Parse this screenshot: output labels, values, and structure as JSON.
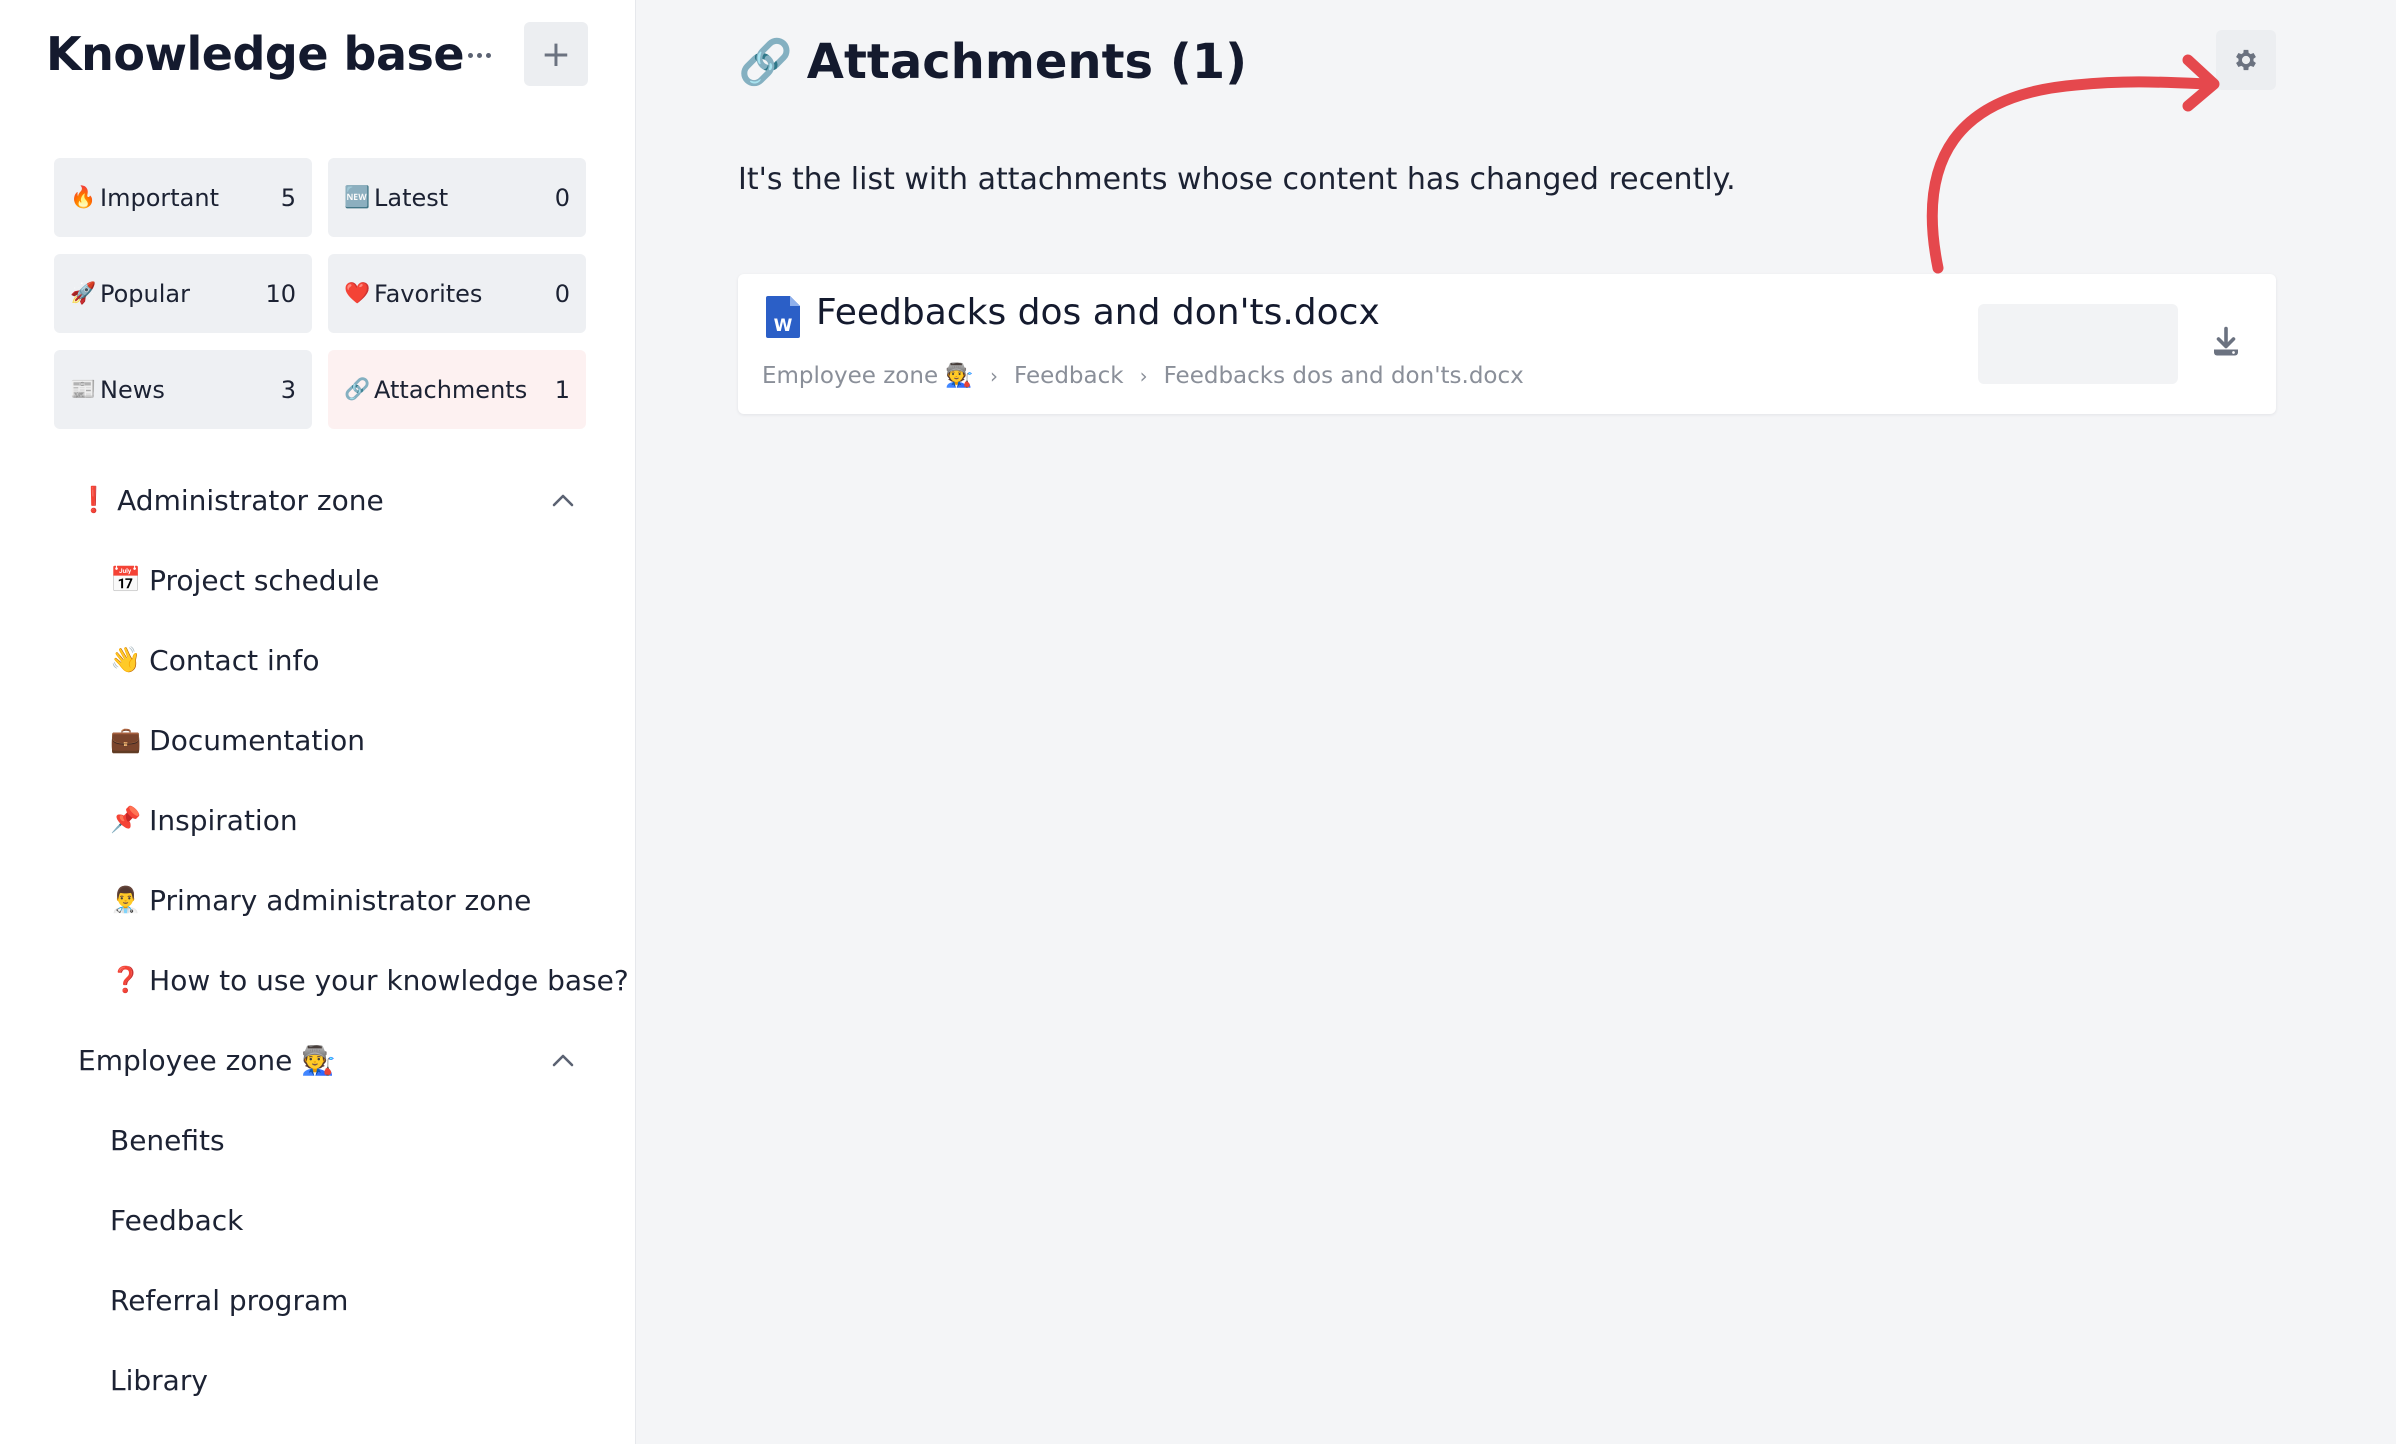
{
  "sidebar": {
    "title": "Knowledge base",
    "tiles": [
      {
        "icon": "🔥",
        "label": "Important",
        "count": "5"
      },
      {
        "icon": "🆕",
        "label": "Latest",
        "count": "0"
      },
      {
        "icon": "🚀",
        "label": "Popular",
        "count": "10"
      },
      {
        "icon": "❤️",
        "label": "Favorites",
        "count": "0"
      },
      {
        "icon": "📰",
        "label": "News",
        "count": "3"
      },
      {
        "icon": "🔗",
        "label": "Attachments",
        "count": "1"
      }
    ],
    "sections": [
      {
        "icon": "❗",
        "label": "Administrator zone",
        "children": [
          {
            "icon": "📅",
            "label": "Project schedule"
          },
          {
            "icon": "👋",
            "label": "Contact info"
          },
          {
            "icon": "💼",
            "label": "Documentation"
          },
          {
            "icon": "📌",
            "label": "Inspiration"
          },
          {
            "icon": "👨‍⚕️",
            "label": "Primary administrator zone"
          },
          {
            "icon": "❓",
            "label": "How to use your knowledge base?"
          }
        ]
      },
      {
        "icon": "",
        "label": "Employee zone 🧑‍🏭",
        "children": [
          {
            "icon": "",
            "label": "Benefits"
          },
          {
            "icon": "",
            "label": "Feedback"
          },
          {
            "icon": "",
            "label": "Referral program"
          },
          {
            "icon": "",
            "label": "Library"
          }
        ]
      }
    ]
  },
  "main": {
    "title_icon": "🔗",
    "title": "Attachments (1)",
    "description": "It's the list with attachments whose content has changed recently.",
    "attachment": {
      "file_name": "Feedbacks dos and don'ts.docx",
      "breadcrumb": [
        "Employee zone 🧑‍🏭",
        "Feedback",
        "Feedbacks dos and don'ts.docx"
      ],
      "breadcrumb_sep": "›"
    }
  },
  "colors": {
    "accent_red": "#e5484d",
    "word_blue": "#2b579a",
    "active_tile": "#fdf1f1"
  }
}
